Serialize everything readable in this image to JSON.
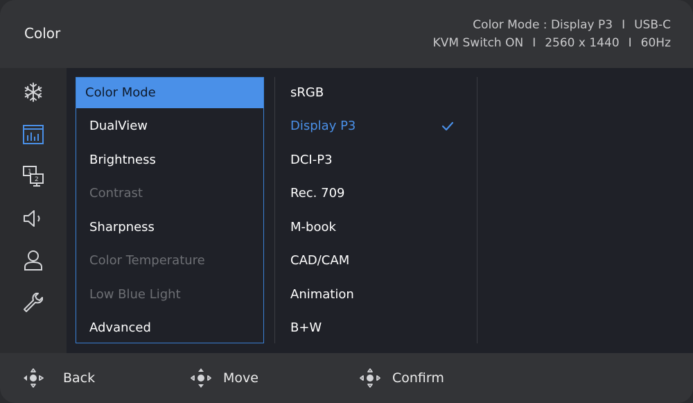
{
  "header": {
    "title": "Color",
    "status_line1_a": "Color Mode : Display P3",
    "status_line1_b": "USB-C",
    "status_line2_a": "KVM Switch ON",
    "status_line2_b": "2560 x 1440",
    "status_line2_c": "60Hz",
    "separator": "I"
  },
  "sidebar": {
    "icons": [
      "snowflake-icon",
      "color-bars-icon",
      "multi-display-icon",
      "speaker-icon",
      "user-icon",
      "wrench-icon"
    ]
  },
  "menu": {
    "items": [
      {
        "label": "Color Mode",
        "state": "selected"
      },
      {
        "label": "DualView",
        "state": "normal"
      },
      {
        "label": "Brightness",
        "state": "normal"
      },
      {
        "label": "Contrast",
        "state": "disabled"
      },
      {
        "label": "Sharpness",
        "state": "normal"
      },
      {
        "label": "Color Temperature",
        "state": "disabled"
      },
      {
        "label": "Low Blue Light",
        "state": "disabled"
      },
      {
        "label": "Advanced",
        "state": "normal"
      }
    ]
  },
  "options": {
    "items": [
      "sRGB",
      "Display P3",
      "DCI-P3",
      "Rec. 709",
      "M-book",
      "CAD/CAM",
      "Animation",
      "B+W"
    ],
    "selected": "Display P3"
  },
  "footer": {
    "back": "Back",
    "move": "Move",
    "confirm": "Confirm"
  },
  "colors": {
    "accent": "#4a90e8",
    "panel": "#1f2128",
    "header": "#333437",
    "disabled_text": "#6d6f74"
  }
}
